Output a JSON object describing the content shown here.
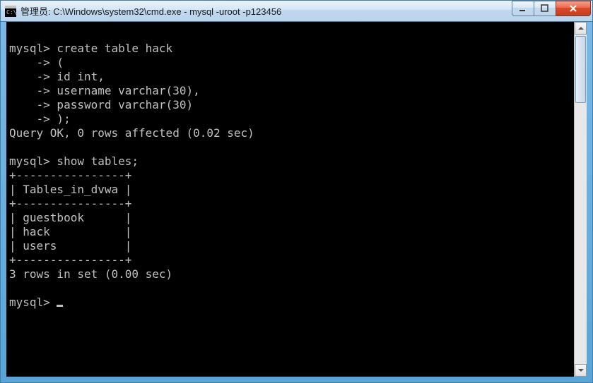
{
  "titlebar": {
    "text": "管理员: C:\\Windows\\system32\\cmd.exe - mysql  -uroot -p123456"
  },
  "terminal": {
    "lines": [
      "",
      "mysql> create table hack",
      "    -> (",
      "    -> id int,",
      "    -> username varchar(30),",
      "    -> password varchar(30)",
      "    -> );",
      "Query OK, 0 rows affected (0.02 sec)",
      "",
      "mysql> show tables;",
      "+----------------+",
      "| Tables_in_dvwa |",
      "+----------------+",
      "| guestbook      |",
      "| hack           |",
      "| users          |",
      "+----------------+",
      "3 rows in set (0.00 sec)",
      "",
      "mysql> "
    ]
  }
}
